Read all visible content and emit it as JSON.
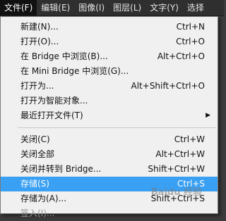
{
  "menubar": {
    "items": [
      "文件(F)",
      "编辑(E)",
      "图像(I)",
      "图层(L)",
      "文字(Y)",
      "选择"
    ]
  },
  "file_menu": {
    "new": {
      "label": "新建(N)...",
      "shortcut": "Ctrl+N"
    },
    "open": {
      "label": "打开(O)...",
      "shortcut": "Ctrl+O"
    },
    "browse_bridge": {
      "label": "在 Bridge 中浏览(B)...",
      "shortcut": "Alt+Ctrl+O"
    },
    "browse_mini_bridge": {
      "label": "在 Mini Bridge 中浏览(G)...",
      "shortcut": ""
    },
    "open_as": {
      "label": "打开为...",
      "shortcut": "Alt+Shift+Ctrl+O"
    },
    "open_smart": {
      "label": "打开为智能对象...",
      "shortcut": ""
    },
    "recent": {
      "label": "最近打开文件(T)",
      "shortcut": ""
    },
    "close": {
      "label": "关闭(C)",
      "shortcut": "Ctrl+W"
    },
    "close_all": {
      "label": "关闭全部",
      "shortcut": "Alt+Ctrl+W"
    },
    "close_bridge": {
      "label": "关闭并转到 Bridge...",
      "shortcut": "Shift+Ctrl+W"
    },
    "save": {
      "label": "存储(S)",
      "shortcut": "Ctrl+S"
    },
    "save_as": {
      "label": "存储为(A)...",
      "shortcut": "Shift+Ctrl+S"
    },
    "checkin": {
      "label": "签入(I)...",
      "shortcut": ""
    }
  },
  "watermark": "Baidu 经验"
}
